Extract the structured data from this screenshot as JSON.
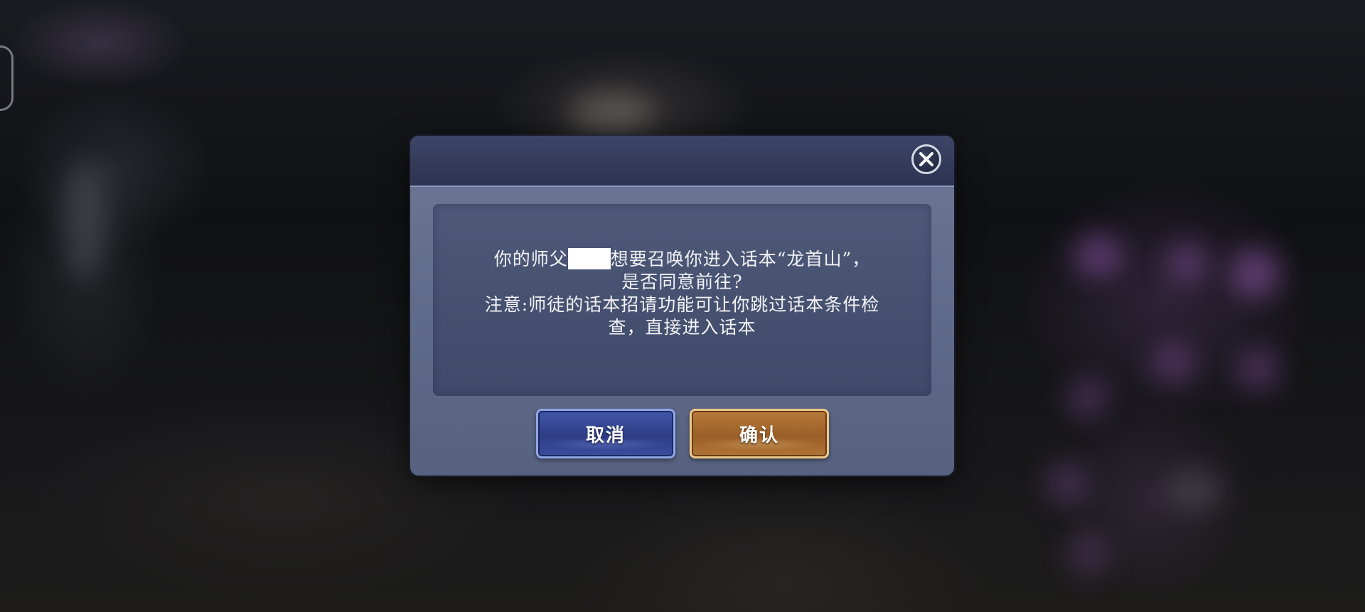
{
  "dialog": {
    "message_line1_before_name": "你的师父",
    "message_line1_after_name": "想要召唤你进入话本“龙首山”，",
    "message_line2": "是否同意前往?",
    "notice_line1": "注意:师徒的话本招请功能可让你跳过话本条件检",
    "notice_line2": "查，直接进入话本",
    "cancel_label": "取消",
    "confirm_label": "确认",
    "close_icon": "close-icon"
  },
  "colors": {
    "header": "#2d3352",
    "panel": "#5e6a89",
    "cancel_button": "#2e3d86",
    "confirm_button": "#9a5f27"
  }
}
